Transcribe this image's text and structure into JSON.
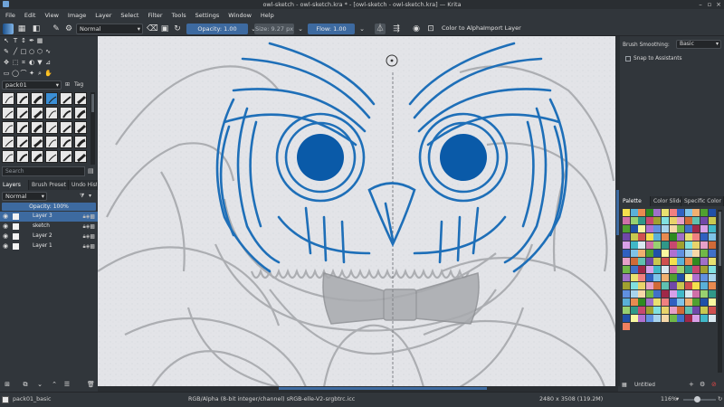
{
  "window": {
    "title": "owl-sketch - owl-sketch.kra * - [owl-sketch - owl-sketch.kra] — Krita"
  },
  "menu": [
    "File",
    "Edit",
    "View",
    "Image",
    "Layer",
    "Select",
    "Filter",
    "Tools",
    "Settings",
    "Window",
    "Help"
  ],
  "toolbar": {
    "blend_mode": "Normal",
    "opacity_label": "Opacity:  1.00",
    "size_label": "Size:  9.27 px",
    "flow_label": "Flow:  1.00",
    "color_to_alpha": "Color to Alpha",
    "import_layer": "Import Layer"
  },
  "presets": {
    "tag_combo": "pack01",
    "tag_button": "Tag",
    "search_placeholder": "Search"
  },
  "docker_tabs": [
    "Layers",
    "Brush Preset H...",
    "Undo Hist..."
  ],
  "layers": {
    "blend_mode": "Normal",
    "opacity_label": "Opacity:  100%",
    "items": [
      {
        "name": "Layer 3",
        "selected": true
      },
      {
        "name": "sketch",
        "selected": false
      },
      {
        "name": "Layer 2",
        "selected": false
      },
      {
        "name": "Layer 1",
        "selected": false
      }
    ]
  },
  "right_panel": {
    "brush_smoothing_label": "Brush Smoothing:",
    "brush_smoothing_value": "Basic",
    "snap_label": "Snap to Assistants",
    "tabs": [
      "Palette",
      "Color Slide...",
      "Specific Color Sel..."
    ],
    "palette_name": "Untitled"
  },
  "status": {
    "preset": "pack01_basic",
    "color_info": "RGB/Alpha (8-bit integer/channel)  sRGB-elle-V2-srgbtrc.icc",
    "image_size": "2480 x 3508 (119.2M)",
    "zoom": "116%"
  },
  "colors": {
    "accent": "#3d6aa0",
    "owl_ink": "#1e6fb8",
    "owl_eye": "#0a5aa8"
  }
}
